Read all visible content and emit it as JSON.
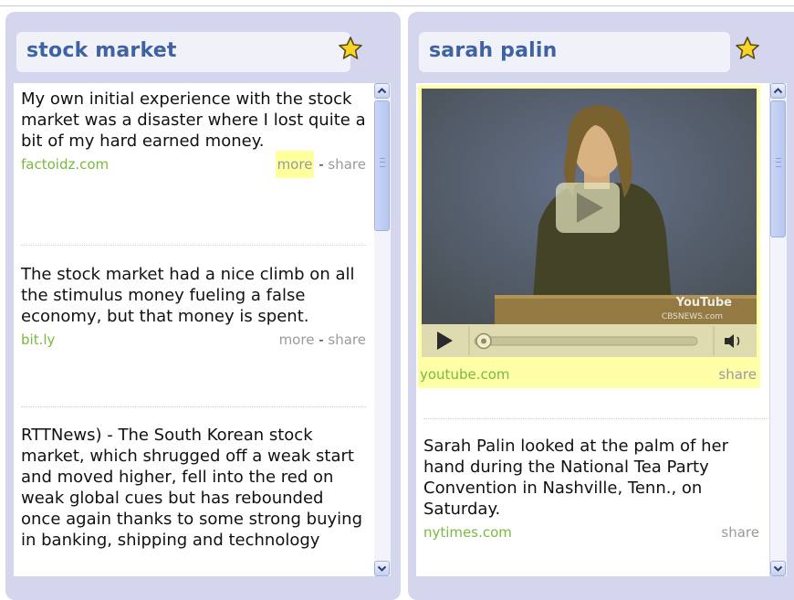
{
  "panels": [
    {
      "title": "stock market",
      "items": [
        {
          "text": "My own initial experience with the stock market was a disaster where I lost quite a bit of my hard earned money.",
          "source": "factoidz.com",
          "more": "more",
          "sep": "-",
          "share": "share"
        },
        {
          "text": "The stock market had a nice climb on all the stimulus money fueling a false economy, but that money is spent.",
          "source": "bit.ly",
          "more": "more",
          "sep": "-",
          "share": "share"
        },
        {
          "text": "RTTNews) - The South Korean stock market, which shrugged off a weak start and moved higher, fell into the red on weak global cues but has rebounded once again thanks to some strong buying in banking, shipping and technology"
        }
      ]
    },
    {
      "title": "sarah palin",
      "video": {
        "source": "youtube.com",
        "share": "share",
        "watermark": "YouTube",
        "overlay": "CBSNEWS.com"
      },
      "items": [
        {
          "text": "Sarah Palin looked at the palm of her hand during the National Tea Party Convention in Nashville, Tenn., on Saturday.",
          "source": "nytimes.com",
          "share": "share"
        }
      ]
    }
  ],
  "colors": {
    "panel_bg": "#d4d6ee",
    "title": "#3f62a0",
    "source": "#79b93d",
    "highlight": "#ffff9e",
    "star": "#f7d428"
  },
  "icons": [
    "star-icon",
    "scroll-up-arrow-icon",
    "scroll-down-arrow-icon",
    "play-icon",
    "volume-icon"
  ]
}
